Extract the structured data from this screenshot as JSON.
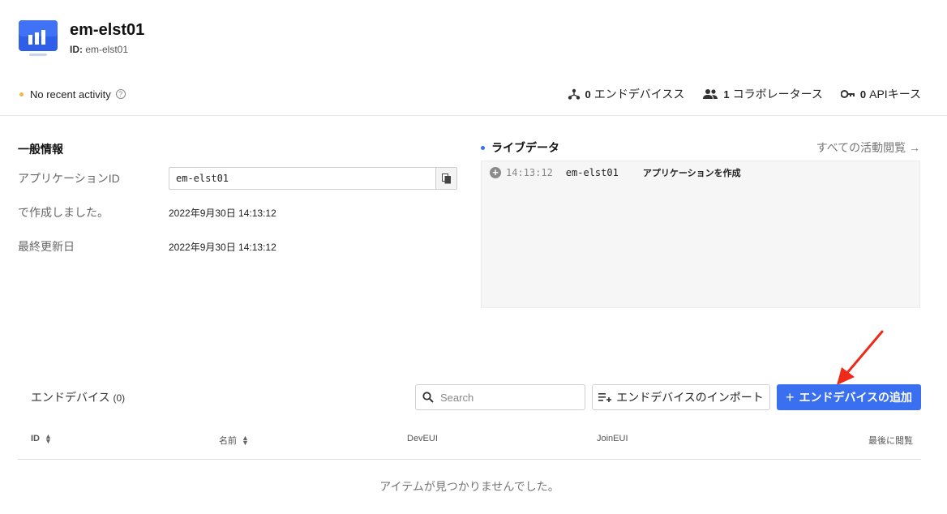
{
  "app": {
    "title": "em-elst01",
    "id_label": "ID:",
    "id_value": "em-elst01"
  },
  "status": {
    "activity": "No recent activity",
    "stats": [
      {
        "count": "0",
        "label": "エンドデバイスス",
        "icon": "device-network-icon"
      },
      {
        "count": "1",
        "label": "コラボレータース",
        "icon": "people-icon"
      },
      {
        "count": "0",
        "label": "APIキース",
        "icon": "key-icon"
      }
    ]
  },
  "general": {
    "title": "一般情報",
    "app_id_label": "アプリケーションID",
    "app_id_value": "em-elst01",
    "created_label": "で作成しました。",
    "created_value": "2022年9月30日 14:13:12",
    "updated_label": "最終更新日",
    "updated_value": "2022年9月30日 14:13:12"
  },
  "live": {
    "title": "ライブデータ",
    "link": "すべての活動閲覧 →",
    "events": [
      {
        "time": "14:13:12",
        "app": "em-elst01",
        "desc": "アプリケーションを作成"
      }
    ]
  },
  "devices": {
    "title": "エンドデバイス",
    "count": "(0)",
    "search_placeholder": "Search",
    "import_label": "エンドデバイスのインポート",
    "add_label": "エンドデバイスの追加",
    "columns": {
      "id": "ID",
      "name": "名前",
      "deveui": "DevEUI",
      "joineui": "JoinEUI",
      "last_seen": "最後に閲覧"
    },
    "empty": "アイテムが見つかりませんでした。"
  },
  "colors": {
    "accent": "#3a6ff0",
    "activity_dot": "#f0b64a",
    "annotation_arrow": "#ee2a1b"
  }
}
